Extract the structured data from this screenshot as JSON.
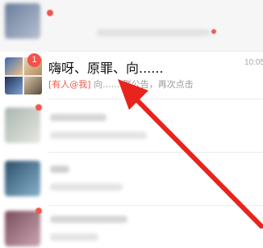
{
  "focused_chat": {
    "badge": "1",
    "title": "嗨呀、原罪、向......",
    "mention_tag": "[有人@我]",
    "preview": "向......:群公告，再次点击",
    "time": "10:05"
  },
  "colors": {
    "badge": "#f4524a",
    "mention": "#f05a4a",
    "arrow": "#e8241c"
  }
}
